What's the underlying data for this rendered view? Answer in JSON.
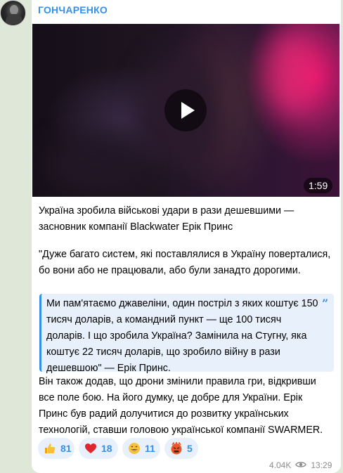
{
  "channel": {
    "name": "ГОНЧАРЕНКО"
  },
  "video": {
    "duration": "1:59"
  },
  "post": {
    "paragraph_1": "Україна зробила військові удари в рази дешевшими — засновник компанії Blackwater Ерік Принс",
    "paragraph_2": "\"Дуже багато систем, які поставлялися в Україну поверталися, бо вони або не працювали, або були занадто дорогими.",
    "quote": "Ми пам'ятаємо джавеліни, один постріл з яких коштує 150 тисяч доларів, а командний пункт — ще 100 тисяч доларів. І що зробила Україна? Замінила на Стугну, яка коштує 22 тисяч доларів, що зробило війну в рази дешевшою\" — Ерік Принс.",
    "paragraph_3": "Він також додав, що дрони змінили правила гри, відкривши все поле бою. На його думку, це добре для України. Ерік Принс був радий долучитися до розвитку українських технологій, ставши головою української компанії SWARMER."
  },
  "reactions": [
    {
      "emoji": "thumbs-up",
      "count": "81"
    },
    {
      "emoji": "heart",
      "count": "18"
    },
    {
      "emoji": "grinning-face",
      "count": "11"
    },
    {
      "emoji": "angry-face",
      "count": "5"
    }
  ],
  "meta": {
    "views": "4.04K",
    "time": "13:29"
  },
  "colors": {
    "accent": "#3390ec",
    "reaction_bg": "#e8f1fb",
    "background": "#dfe7d8"
  }
}
